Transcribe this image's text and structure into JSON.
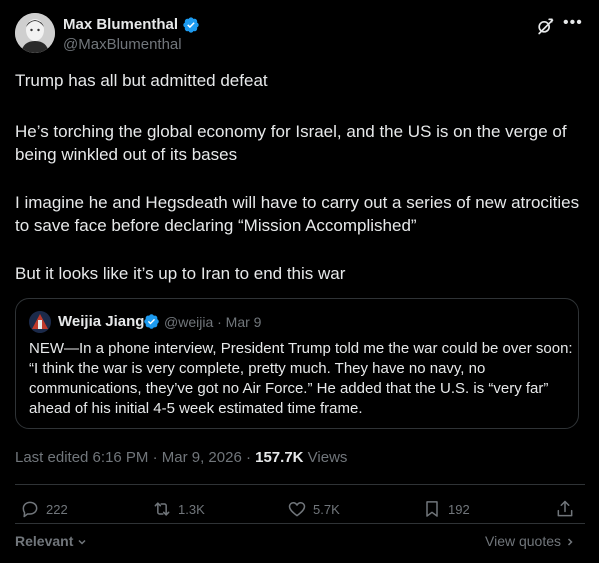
{
  "author": {
    "name": "Max Blumenthal",
    "handle": "@MaxBlumenthal"
  },
  "post": {
    "paragraphs": [
      "Trump has all but admitted defeat",
      "He’s torching the global economy for Israel, and the US is on the verge of being winkled out of its bases",
      "I imagine he and Hegsdeath will have to carry out a series of new atrocities to save face before declaring “Mission Accomplished”",
      "But it looks like it’s up to Iran to end this war"
    ]
  },
  "quoted": {
    "name": "Weijia Jiang",
    "handle_date": "@weijia · Mar 9",
    "text": "NEW—In a phone interview, President Trump told me the war could be over soon: “I think the war is very complete, pretty much. They have no navy, no communications, they’ve got no Air Force.” He added that the U.S. is “very far” ahead of his initial 4-5 week estimated time frame."
  },
  "meta": {
    "edited": "Last edited 6:16 PM · Mar 9, 2026 · ",
    "views_count": "157.7K",
    "views_label": " Views"
  },
  "actions": {
    "replies": "222",
    "reposts": "1.3K",
    "likes": "5.7K",
    "bookmarks": "192"
  },
  "footer": {
    "sort": "Relevant",
    "view_quotes": "View quotes"
  },
  "colors": {
    "background": "#000000",
    "text": "#e7e9ea",
    "muted": "#71767b",
    "verified": "#1d9bf0",
    "border": "#2f3336"
  }
}
